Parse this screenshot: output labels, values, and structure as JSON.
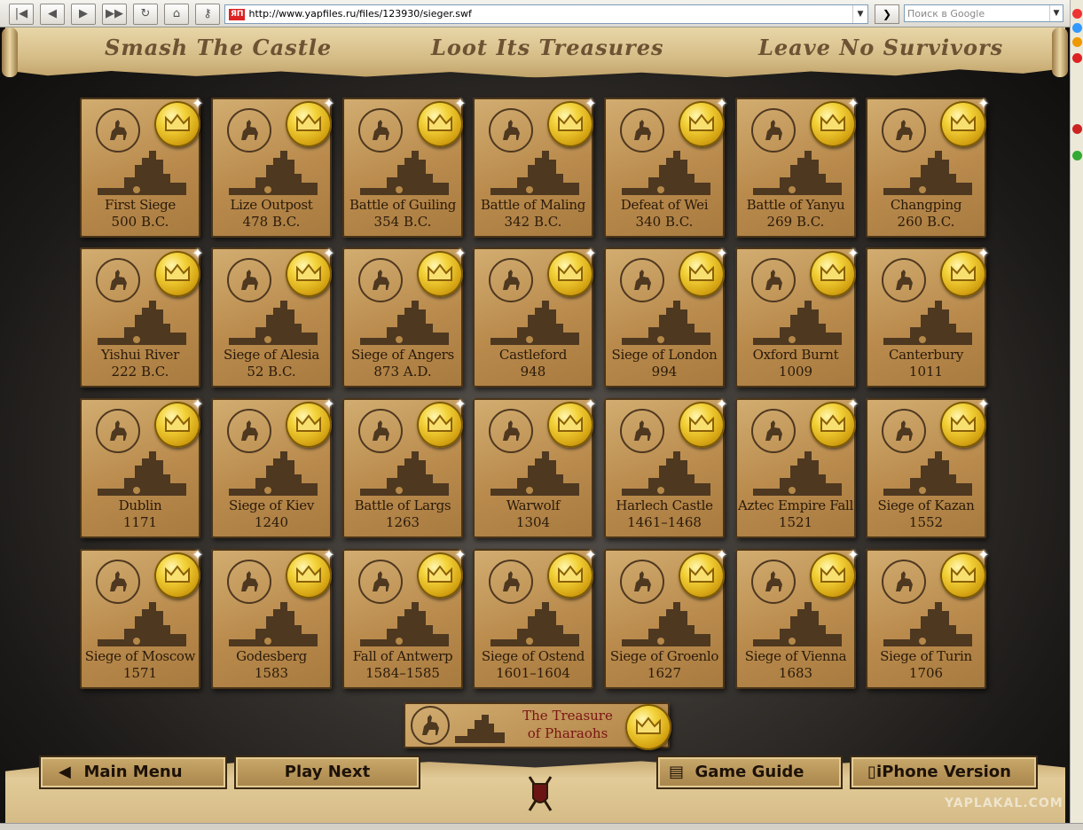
{
  "browser": {
    "url": "http://www.yapfiles.ru/files/123930/sieger.swf",
    "search_placeholder": "Поиск в Google",
    "ya_badge": "ЯП"
  },
  "banner": {
    "left": "Smash The Castle",
    "center": "Loot Its Treasures",
    "right": "Leave No Survivors"
  },
  "levels": [
    {
      "name": "First Siege",
      "year": "500 B.C."
    },
    {
      "name": "Lize Outpost",
      "year": "478 B.C."
    },
    {
      "name": "Battle of Guiling",
      "year": "354 B.C."
    },
    {
      "name": "Battle of Maling",
      "year": "342 B.C."
    },
    {
      "name": "Defeat of Wei",
      "year": "340 B.C."
    },
    {
      "name": "Battle of Yanyu",
      "year": "269 B.C."
    },
    {
      "name": "Changping",
      "year": "260 B.C."
    },
    {
      "name": "Yishui River",
      "year": "222 B.C."
    },
    {
      "name": "Siege of Alesia",
      "year": "52 B.C."
    },
    {
      "name": "Siege of Angers",
      "year": "873 A.D."
    },
    {
      "name": "Castleford",
      "year": "948"
    },
    {
      "name": "Siege of London",
      "year": "994"
    },
    {
      "name": "Oxford Burnt",
      "year": "1009"
    },
    {
      "name": "Canterbury",
      "year": "1011"
    },
    {
      "name": "Dublin",
      "year": "1171"
    },
    {
      "name": "Siege of Kiev",
      "year": "1240"
    },
    {
      "name": "Battle of Largs",
      "year": "1263"
    },
    {
      "name": "Warwolf",
      "year": "1304"
    },
    {
      "name": "Harlech Castle",
      "year": "1461–1468"
    },
    {
      "name": "Aztec Empire Fall",
      "year": "1521"
    },
    {
      "name": "Siege of Kazan",
      "year": "1552"
    },
    {
      "name": "Siege of Moscow",
      "year": "1571"
    },
    {
      "name": "Godesberg",
      "year": "1583"
    },
    {
      "name": "Fall of Antwerp",
      "year": "1584–1585"
    },
    {
      "name": "Siege of Ostend",
      "year": "1601–1604"
    },
    {
      "name": "Siege of Groenlo",
      "year": "1627"
    },
    {
      "name": "Siege of Vienna",
      "year": "1683"
    },
    {
      "name": "Siege of Turin",
      "year": "1706"
    }
  ],
  "bonus": {
    "line1": "The Treasure",
    "line2": "of Pharaohs"
  },
  "footer": {
    "main_menu": "Main Menu",
    "play_next": "Play Next",
    "game_guide": "Game Guide",
    "iphone": "iPhone Version"
  },
  "watermark": "YAPLAKAL.COM",
  "colors": {
    "parchment": "#c49a5c",
    "gold": "#f3d23a",
    "bonus_text": "#7a1414"
  }
}
